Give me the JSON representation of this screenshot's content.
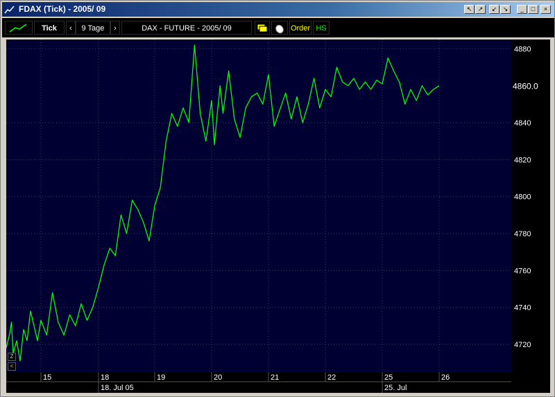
{
  "window": {
    "title": "FDAX  (Tick) - 2005/ 09"
  },
  "title_buttons": [
    "↖",
    "↗",
    "↙",
    "↘",
    "_",
    "□",
    "×"
  ],
  "toolbar": {
    "mode_label": "Tick",
    "prev_arrow": "‹",
    "period_label": "9 Tage",
    "next_arrow": "›",
    "instrument_label": "DAX - FUTURE - 2005/ 09",
    "order_label": "Order",
    "hs_label": "HS"
  },
  "zoom_buttons": [
    "Z",
    "<"
  ],
  "colors": {
    "plot_bg": "#000033",
    "line": "#00ff00",
    "grid": "#3a3a6a",
    "last_price": "#ffff00"
  },
  "chart_data": {
    "type": "line",
    "title": "DAX - FUTURE - 2005/ 09",
    "ylim": [
      4705,
      4885
    ],
    "y_ticks": [
      4720,
      4740,
      4760,
      4780,
      4800,
      4820,
      4840,
      4880
    ],
    "last_price_label": "4860.0",
    "last_price": 4860,
    "day_ticks": [
      "15",
      "18",
      "19",
      "20",
      "21",
      "22",
      "25",
      "26"
    ],
    "date_ticks": [
      "18. Jul 05",
      "25. Jul"
    ],
    "grid": true,
    "series": [
      {
        "x": [
          0,
          0.1,
          0.15,
          0.2,
          0.3,
          0.4,
          0.5,
          0.6,
          0.7,
          0.8,
          0.9,
          1,
          1.1,
          1.2,
          1.3,
          1.4,
          1.5,
          1.6,
          1.7,
          1.8,
          1.9,
          2,
          2.1,
          2.2,
          2.3,
          2.4,
          2.5,
          2.6,
          2.7,
          2.8,
          2.9,
          3,
          3.1,
          3.2,
          3.3,
          3.4,
          3.5,
          3.6,
          3.7,
          3.8,
          3.9,
          4,
          4.05,
          4.1,
          4.15,
          4.2,
          4.3,
          4.4,
          4.5,
          4.6,
          4.7,
          4.8,
          4.9,
          5,
          5.1,
          5.2,
          5.3,
          5.4,
          5.5,
          5.6,
          5.7,
          5.8,
          5.9,
          6,
          6.1,
          6.2,
          6.3,
          6.4,
          6.5,
          6.6,
          6.7,
          6.8,
          6.9,
          7,
          7.1,
          7.2,
          7.3,
          7.4,
          7.5,
          7.6,
          7.7,
          7.8,
          7.9,
          8
        ],
        "y": [
          4718,
          4726,
          4732,
          4715,
          4722,
          4711,
          4728,
          4722,
          4738,
          4730,
          4722,
          4733,
          4725,
          4748,
          4732,
          4725,
          4736,
          4730,
          4742,
          4733,
          4740,
          4751,
          4763,
          4772,
          4768,
          4790,
          4780,
          4798,
          4793,
          4786,
          4776,
          4795,
          4805,
          4830,
          4845,
          4838,
          4848,
          4840,
          4882,
          4845,
          4830,
          4852,
          4828,
          4845,
          4860,
          4845,
          4868,
          4842,
          4832,
          4848,
          4854,
          4856,
          4850,
          4866,
          4838,
          4847,
          4856,
          4842,
          4854,
          4840,
          4850,
          4864,
          4848,
          4858,
          4854,
          4870,
          4862,
          4860,
          4864,
          4858,
          4862,
          4858,
          4863,
          4861,
          4875,
          4868,
          4862,
          4850,
          4858,
          4852,
          4860,
          4855,
          4858,
          4860
        ]
      }
    ]
  }
}
